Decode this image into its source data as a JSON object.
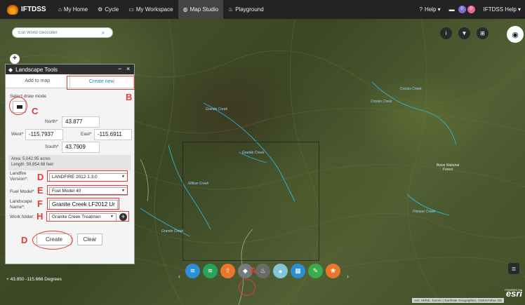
{
  "nav": {
    "brand": "IFTDSS",
    "tabs": [
      {
        "icon": "home-icon",
        "glyph": "⌂",
        "label": "My Home"
      },
      {
        "icon": "cycle-icon",
        "glyph": "⚙",
        "label": "Cycle"
      },
      {
        "icon": "workspace-icon",
        "glyph": "▭",
        "label": "My Workspace"
      },
      {
        "icon": "globe-icon",
        "glyph": "◍",
        "label": "Map Studio"
      },
      {
        "icon": "fire-icon",
        "glyph": "♨",
        "label": "Playground"
      }
    ],
    "help_label": "Help ▾",
    "badge_one": "0",
    "badge_two": "0",
    "user_help": "IFTDSS Help ▾",
    "colors": {
      "badge_one": "#7a6fd9",
      "badge_two": "#e36a9b"
    }
  },
  "map": {
    "geocoder_placeholder": "Esri World Geocoder",
    "coords_text": "43.850 -115.666 Degrees",
    "attribution": "esri, HERE, Garmin | Earthstar Geographics, CNES/Airbus DS",
    "esri_logo": "esri",
    "esri_powered": "POWERED BY",
    "labels": {
      "l1": "Granite Creek",
      "l2": "Crooks Creek",
      "l3": "Boise National Forest",
      "l4": "Granite Creek",
      "l5": "Willow Creek",
      "l6": "Pioneer Creek",
      "l7": "Granite Creek",
      "l8": "Crooks Creek"
    }
  },
  "panel": {
    "title": "Landscape Tools",
    "tab_add": "Add to map",
    "tab_create": "Create new",
    "draw_mode_label": "Select draw mode",
    "north_label": "North*",
    "north_value": "43.877",
    "west_label": "West*",
    "west_value": "-115.7937",
    "east_label": "East*",
    "east_value": "-115.6911",
    "south_label": "South*",
    "south_value": "43.7909",
    "area_text": "Area: 5,042.95 acres",
    "length_text": "Length: 59,854.68 feet",
    "landfire_label_1": "Landfire",
    "landfire_label_2": "Version*:",
    "landfire_value": "LANDFIRE 2012 1.3.0",
    "fuel_model_label": "Fuel Model*",
    "fuel_model_value": "Fuel Model 40",
    "landscape_label_1": "Landscape",
    "landscape_label_2": "Name*:",
    "landscape_value": "Granite Creek LF2012 Ur",
    "work_folder_label": "Work folder:",
    "work_folder_value": "Granite Creek Treatmen",
    "create_label": "Create",
    "clear_label": "Clear"
  },
  "annotations": {
    "a": "A",
    "b": "B",
    "c": "C",
    "d1": "D",
    "e": "E",
    "f": "F",
    "g": "H",
    "d2": "D",
    "color": "#e23b3b"
  },
  "toolbar": {
    "buttons": [
      {
        "name": "layers-icon",
        "glyph": "≋",
        "color": "#2b8fd6"
      },
      {
        "name": "basemap-icon",
        "glyph": "≋",
        "color": "#27a35a"
      },
      {
        "name": "upload-icon",
        "glyph": "⇧",
        "color": "#e8762b"
      },
      {
        "name": "landscape-tool-icon",
        "glyph": "◆",
        "color": "#7a7a7a"
      },
      {
        "name": "fire-tool-icon",
        "glyph": "♨",
        "color": "#6b6b6b"
      },
      {
        "name": "marker-icon",
        "glyph": "●",
        "color": "#7ec6d8"
      },
      {
        "name": "grid-icon",
        "glyph": "▦",
        "color": "#2b8fd6"
      },
      {
        "name": "draw-icon",
        "glyph": "✎",
        "color": "#3cab4e"
      },
      {
        "name": "palette-icon",
        "glyph": "❀",
        "color": "#e8762b"
      }
    ]
  }
}
